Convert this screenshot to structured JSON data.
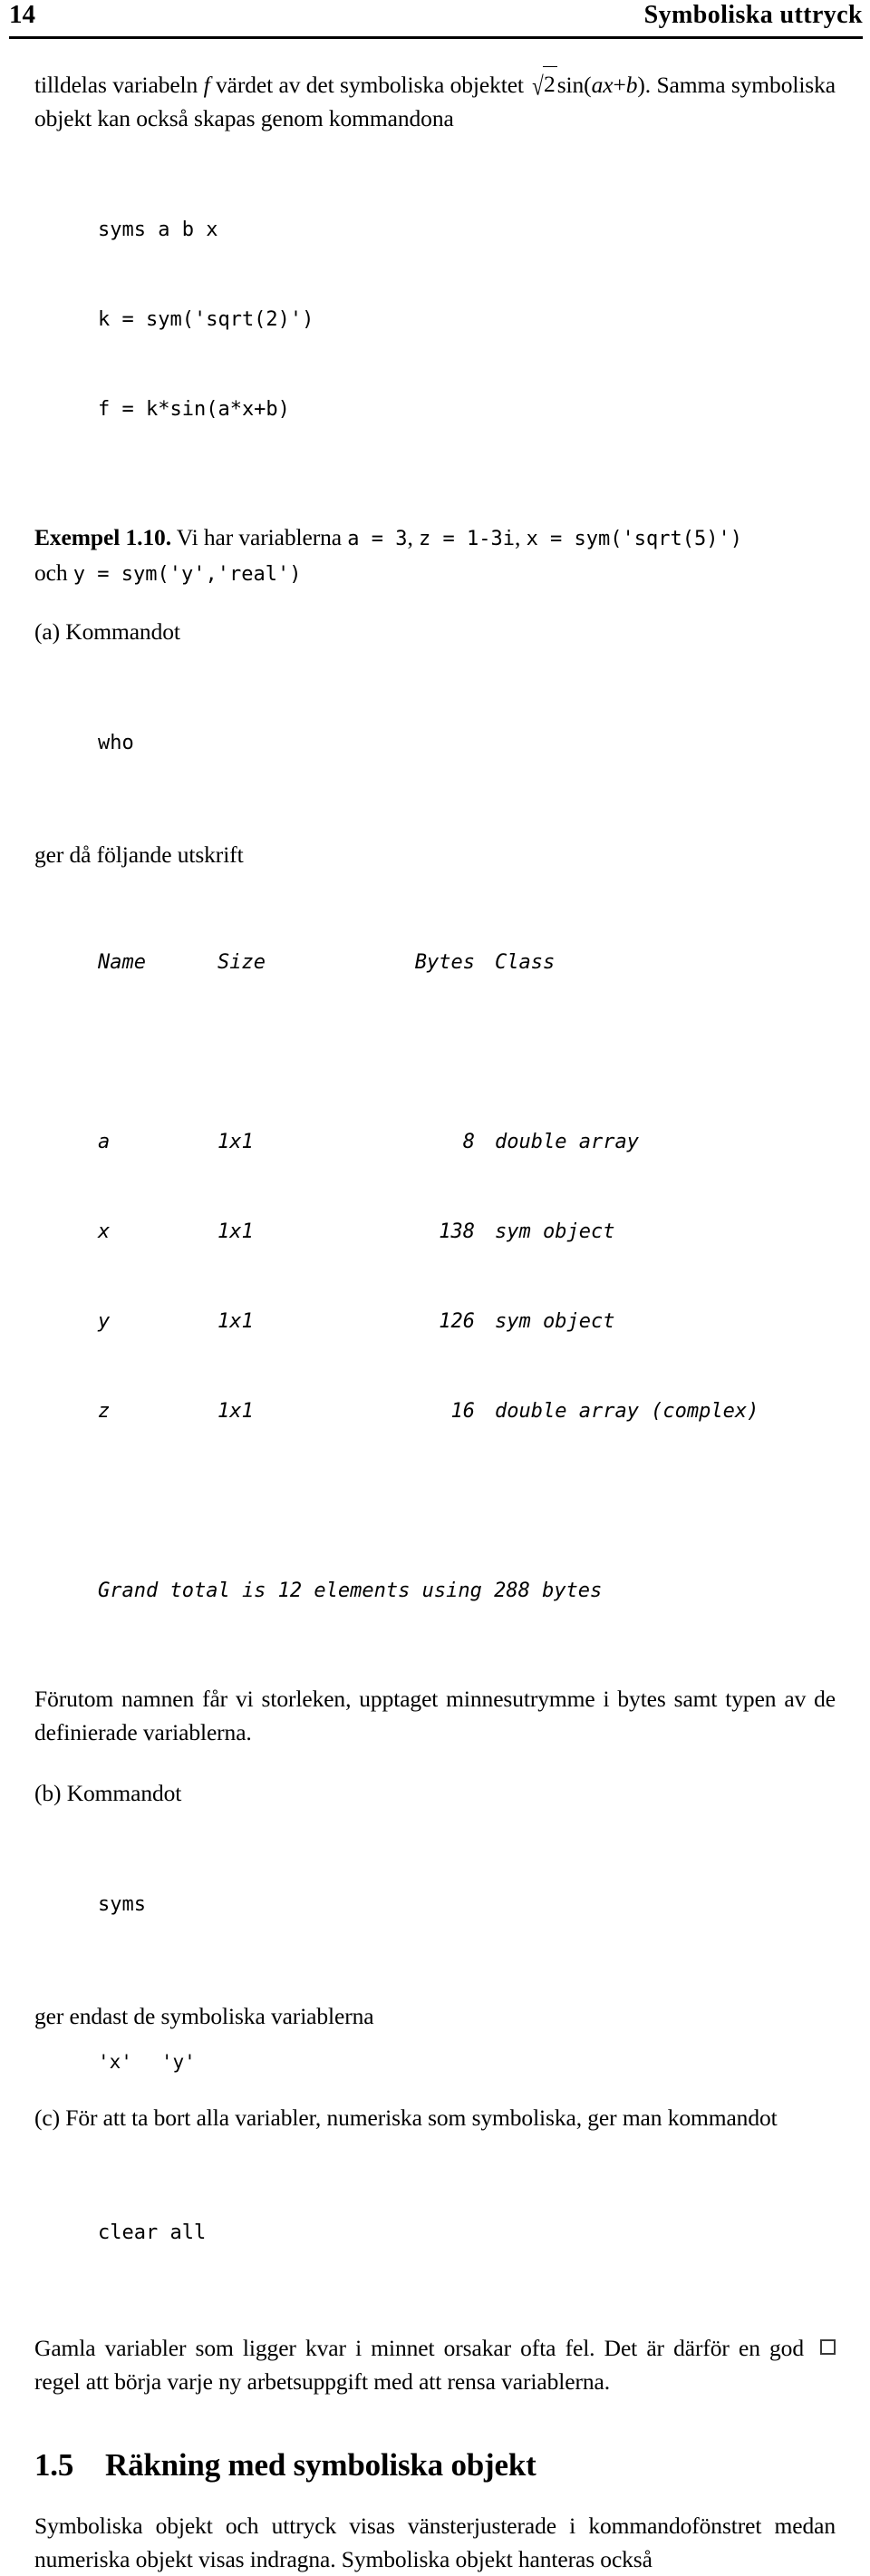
{
  "running_head": {
    "folio": "14",
    "title": "Symboliska uttryck"
  },
  "intro_paragraph": {
    "before_math": "tilldelas variabeln ",
    "var_f": "f",
    "middle": " värdet av det symboliska objektet ",
    "math": {
      "radical": "√",
      "radicand": "2",
      "function": "sin",
      "open_paren": "(",
      "arg_a": "a",
      "arg_x": "x",
      "plus": "+",
      "arg_b": "b",
      "close_paren": ")"
    },
    "after_math": ". Samma symboliska objekt kan också skapas genom kommandona"
  },
  "code_block_1": {
    "lines": [
      "syms a b x",
      "k = sym('sqrt(2)')",
      "f = k*sin(a*x+b)"
    ],
    "qed": "□"
  },
  "example": {
    "label": "Exempel 1.10.",
    "lead_text_1": " Vi har variablerna ",
    "code_a": "a = 3",
    "sep1": ", ",
    "code_z": "z = 1-3i",
    "sep2": ", ",
    "code_x": "x = sym('sqrt(5)')",
    "line2_prefix": "och ",
    "code_y": "y = sym('y','real')"
  },
  "part_a": {
    "label": "(a) Kommandot",
    "command": "who",
    "after": "ger då följande utskrift",
    "table": {
      "headers": [
        "Name",
        "Size",
        "Bytes",
        "Class"
      ],
      "rows": [
        {
          "name": "a",
          "size": "1x1",
          "bytes": "8",
          "class": "double array"
        },
        {
          "name": "x",
          "size": "1x1",
          "bytes": "138",
          "class": "sym object"
        },
        {
          "name": "y",
          "size": "1x1",
          "bytes": "126",
          "class": "sym object"
        },
        {
          "name": "z",
          "size": "1x1",
          "bytes": "16",
          "class": "double array (complex)"
        }
      ],
      "total": "Grand total is 12 elements using 288 bytes"
    },
    "explanation": "Förutom namnen får vi storleken, upptaget minnesutrymme i bytes samt typen av de definierade variablerna."
  },
  "part_b": {
    "label": "(b) Kommandot",
    "command": "syms",
    "after": "ger endast de symboliska variablerna",
    "symbols": [
      "'x'",
      "'y'"
    ]
  },
  "part_c": {
    "label": "(c) För att ta bort alla variabler, numeriska som symboliska, ger man kommandot",
    "command": "clear all",
    "closing": "Gamla variabler som ligger kvar i minnet orsakar ofta fel. Det är därför en god regel att börja varje ny arbetsuppgift med att rensa variablerna.",
    "qed": "□"
  },
  "section": {
    "number": "1.5",
    "title": "Räkning med symboliska objekt",
    "paragraph": "Symboliska objekt och uttryck visas vänsterjusterade i kommandofönstret medan numeriska objekt visas indragna. Symboliska objekt hanteras också"
  }
}
